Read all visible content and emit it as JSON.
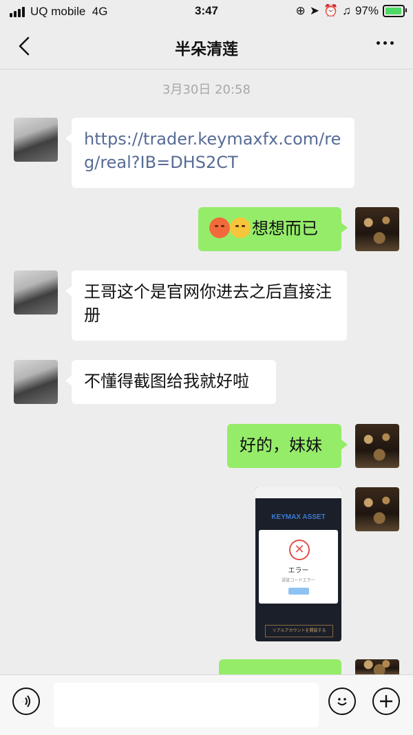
{
  "status_bar": {
    "carrier": "UQ mobile",
    "network": "4G",
    "time": "3:47",
    "battery_pct": "97%",
    "battery_level": 0.97
  },
  "nav": {
    "title": "半朵清莲",
    "back_icon": "chevron-left-icon",
    "more_icon": "more-dots-icon"
  },
  "chat": {
    "timestamp": "3月30日 20:58",
    "messages": [
      {
        "from": "them",
        "type": "link",
        "text": "https://trader.keymaxfx.com/reg/real?IB=DHS2CT"
      },
      {
        "from": "me",
        "type": "text",
        "emojis": [
          "angry-face-icon",
          "sleepy-face-icon"
        ],
        "text": "想想而已"
      },
      {
        "from": "them",
        "type": "text",
        "text": "王哥这个是官网你进去之后直接注册"
      },
      {
        "from": "them",
        "type": "text",
        "text": "不懂得截图给我就好啦"
      },
      {
        "from": "me",
        "type": "text",
        "text": "好的，妹妹"
      },
      {
        "from": "me",
        "type": "image",
        "image": {
          "brand": "KEYMAX ASSET",
          "dialog_title": "エラー",
          "dialog_message": "認証コードエラー",
          "ok_label": "OK",
          "cta_label": "リアルアカウントを開設する"
        }
      }
    ]
  },
  "input_bar": {
    "voice_icon": "voice-icon",
    "emoji_icon": "emoji-icon",
    "plus_icon": "plus-icon",
    "placeholder": ""
  },
  "colors": {
    "background": "#ededed",
    "my_bubble": "#95ec69",
    "their_bubble": "#ffffff",
    "link": "#576b95"
  }
}
